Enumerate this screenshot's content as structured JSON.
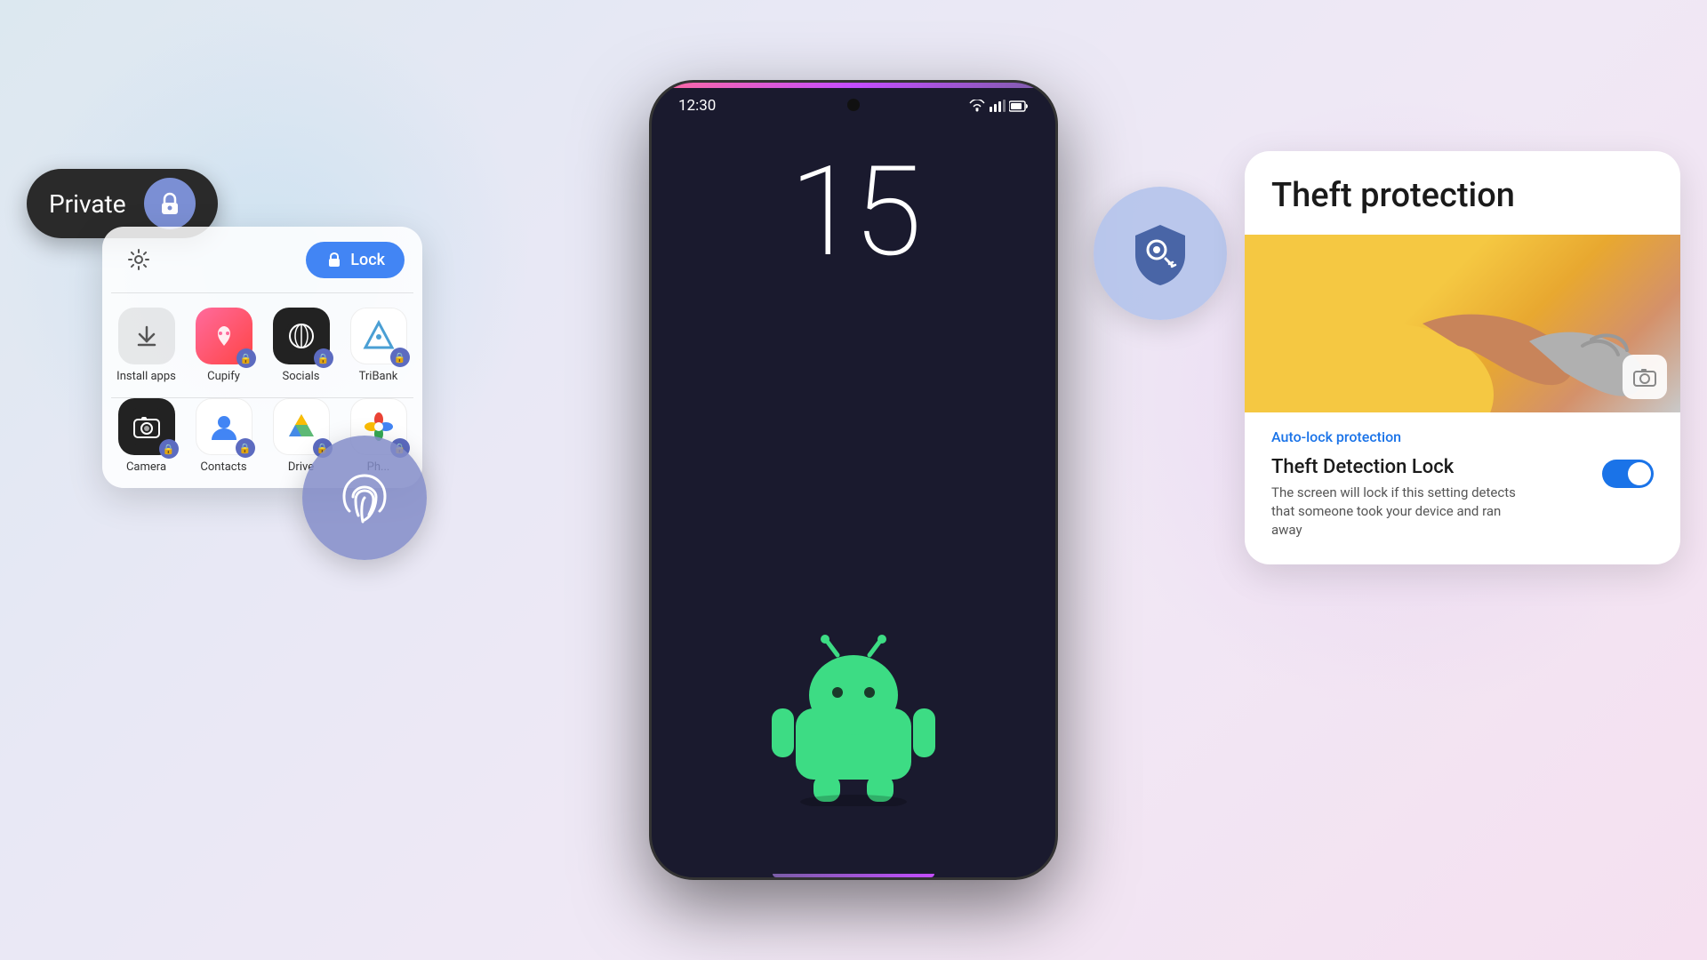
{
  "background": {
    "gradient": "linear-gradient(135deg, #dce8f0, #e8e8f5, #f0e8f5, #f5e0f0)"
  },
  "private_bubble": {
    "label": "Private",
    "icon": "lock-icon"
  },
  "app_drawer": {
    "lock_button": "Lock",
    "gear_icon": "⚙",
    "lock_icon": "🔒",
    "row1": [
      {
        "id": "install-apps",
        "label": "Install apps",
        "type": "install"
      },
      {
        "id": "cupify",
        "label": "Cupify",
        "type": "cupify"
      },
      {
        "id": "socials",
        "label": "Socials",
        "type": "socials"
      },
      {
        "id": "tribank",
        "label": "TriBank",
        "type": "tribank"
      }
    ],
    "row2": [
      {
        "id": "camera",
        "label": "Camera",
        "type": "camera"
      },
      {
        "id": "contacts",
        "label": "Contacts",
        "type": "contacts"
      },
      {
        "id": "drive",
        "label": "Drive",
        "type": "drive"
      },
      {
        "id": "photos",
        "label": "Ph...",
        "type": "photos"
      }
    ]
  },
  "phone": {
    "time": "12:30",
    "date_number": "15"
  },
  "theft_card": {
    "title": "Theft protection",
    "auto_lock_label": "Auto-lock protection",
    "detection_title": "Theft Detection Lock",
    "detection_desc": "The screen will lock if this setting detects that someone took your device and ran away",
    "toggle_state": "on"
  }
}
